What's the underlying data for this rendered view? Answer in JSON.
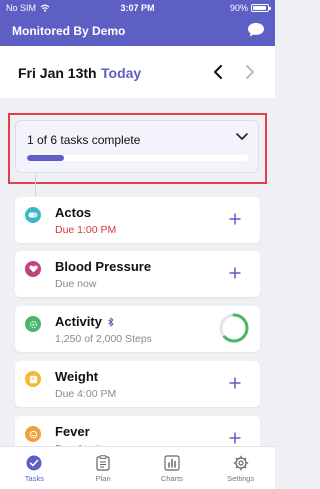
{
  "status_bar": {
    "carrier": "No SIM",
    "time": "3:07 PM",
    "battery": "90%"
  },
  "header": {
    "title": "Monitored By Demo"
  },
  "date_bar": {
    "date": "Fri Jan 13th",
    "today_label": "Today"
  },
  "progress": {
    "text": "1 of 6 tasks complete",
    "fraction": 0.1667
  },
  "tasks": [
    {
      "name": "Actos",
      "subtitle": "Due 1:00 PM",
      "icon": "pill-icon",
      "color": "#3cb7c9",
      "overdue": true
    },
    {
      "name": "Blood Pressure",
      "subtitle": "Due now",
      "icon": "heart-icon",
      "color": "#c2417e"
    },
    {
      "name": "Activity",
      "subtitle": "1,250 of 2,000 Steps",
      "icon": "activity-icon",
      "color": "#4cb56b",
      "progress": 0.625
    },
    {
      "name": "Weight",
      "subtitle": "Due 4:00 PM",
      "icon": "scale-icon",
      "color": "#f2b930"
    },
    {
      "name": "Fever",
      "subtitle": "Due Anytime",
      "icon": "thermometer-icon",
      "color": "#f0a13a"
    }
  ],
  "tabs": [
    {
      "label": "Tasks",
      "icon": "check-circle-icon",
      "active": true
    },
    {
      "label": "Plan",
      "icon": "clipboard-icon"
    },
    {
      "label": "Charts",
      "icon": "bar-chart-icon"
    },
    {
      "label": "Settings",
      "icon": "gear-icon"
    }
  ],
  "colors": {
    "primary": "#5d5fc4",
    "highlight_border": "#e0404a",
    "overdue": "#d23b3b"
  }
}
